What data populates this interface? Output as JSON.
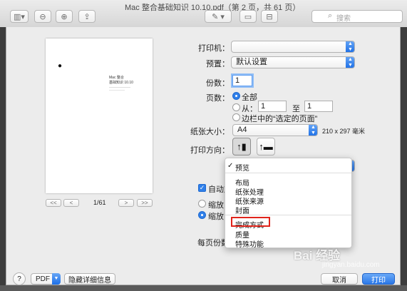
{
  "window": {
    "title": "Mac 整合基础知识 10.10.pdf（第 2 页，共 61 页）"
  },
  "toolbar": {
    "search_placeholder": "搜索"
  },
  "preview": {
    "page_heading_1": "Mac 整合",
    "page_heading_2": "基础知识 10.10",
    "page_indicator": "1/61",
    "first_label": "<<",
    "prev_label": "<",
    "next_label": ">",
    "last_label": ">>"
  },
  "print": {
    "printer_label": "打印机：",
    "presets_label": "预置：",
    "presets_value": "默认设置",
    "copies_label": "份数：",
    "copies_value": "1",
    "pages_label": "页数：",
    "pages_all": "全部",
    "pages_from": "从：",
    "pages_from_value": "1",
    "pages_to": "至",
    "pages_to_value": "1",
    "pages_selection": "边栏中的“选定的页面”",
    "paper_size_label": "纸张大小：",
    "paper_size_value": "A4",
    "paper_dimensions": "210 x 297 毫米",
    "orientation_label": "打印方向：",
    "auto_label": "自动旋",
    "scale_label": "缩放：",
    "scale_fit_label": "缩放以",
    "pages_per_sheet_label": "每页份数"
  },
  "menu": {
    "checkmark": "✓",
    "items_group1": [
      "预览"
    ],
    "items_group2": [
      "布局",
      "纸张处理",
      "纸张来源",
      "封面"
    ],
    "items_group3": [
      "完成方式",
      "质量",
      "特殊功能"
    ]
  },
  "footer": {
    "help_label": "?",
    "pdf_label": "PDF",
    "hide_details_label": "隐藏详细信息",
    "cancel_label": "取消",
    "print_label": "打印"
  },
  "watermark": {
    "text": "Bai 经验",
    "sub": "jingyan.baidu.com"
  },
  "colors": {
    "accent": "#2f7fe9",
    "highlight": "#e0241b"
  }
}
